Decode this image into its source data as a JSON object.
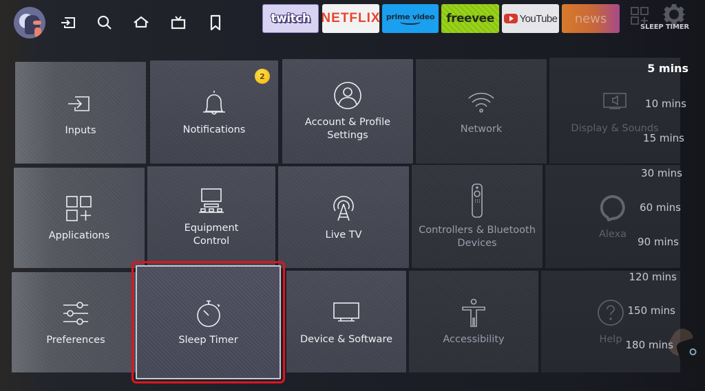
{
  "topbar": {
    "nav_icons": [
      "profile-avatar",
      "inputs-icon",
      "search-icon",
      "home-icon",
      "live-tv-icon",
      "bookmark-icon"
    ],
    "apps": [
      {
        "name": "twitch",
        "label": "twitch",
        "color": "#d7d3f1"
      },
      {
        "name": "netflix",
        "label": "NETFLIX",
        "color": "#e5452f"
      },
      {
        "name": "prime-video",
        "label": "prime video",
        "color": "#1aa0ee"
      },
      {
        "name": "freevee",
        "label": "freevee",
        "color": "#9ad31a"
      },
      {
        "name": "youtube",
        "label": "YouTube",
        "color": "#d33a2c"
      },
      {
        "name": "news",
        "label": "news",
        "color": "#d87a2a"
      }
    ],
    "settings_caption": "SLEEP TIMER"
  },
  "settings": {
    "tiles": [
      {
        "id": "inputs",
        "label": "Inputs",
        "icon": "input-icon"
      },
      {
        "id": "notifications",
        "label": "Notifications",
        "icon": "bell-icon",
        "badge": "2"
      },
      {
        "id": "account",
        "label_line1": "Account & Profile",
        "label_line2": "Settings",
        "icon": "user-icon"
      },
      {
        "id": "network",
        "label": "Network",
        "icon": "wifi-icon"
      },
      {
        "id": "display",
        "label": "Display & Sounds",
        "icon": "display-sound-icon"
      },
      {
        "id": "applications",
        "label": "Applications",
        "icon": "apps-icon"
      },
      {
        "id": "equipment",
        "label_line1": "Equipment",
        "label_line2": "Control",
        "icon": "equipment-icon"
      },
      {
        "id": "live-tv",
        "label": "Live TV",
        "icon": "antenna-icon"
      },
      {
        "id": "controllers",
        "label_line1": "Controllers & Bluetooth",
        "label_line2": "Devices",
        "icon": "remote-icon"
      },
      {
        "id": "alexa",
        "label": "Alexa",
        "icon": "alexa-icon"
      },
      {
        "id": "preferences",
        "label": "Preferences",
        "icon": "sliders-icon"
      },
      {
        "id": "sleep-timer",
        "label": "Sleep Timer",
        "icon": "stopwatch-icon",
        "focused": true
      },
      {
        "id": "device-software",
        "label": "Device & Software",
        "icon": "tv-icon"
      },
      {
        "id": "accessibility",
        "label": "Accessibility",
        "icon": "accessibility-icon"
      },
      {
        "id": "help",
        "label": "Help",
        "icon": "help-icon"
      }
    ]
  },
  "sleep_timer": {
    "options": [
      "5 mins",
      "10 mins",
      "15 mins",
      "30 mins",
      "60 mins",
      "90 mins",
      "120 mins",
      "150 mins",
      "180 mins"
    ],
    "selected": "5 mins"
  },
  "colors": {
    "focus_outline": "#e0141e",
    "badge": "#f0b40a"
  }
}
